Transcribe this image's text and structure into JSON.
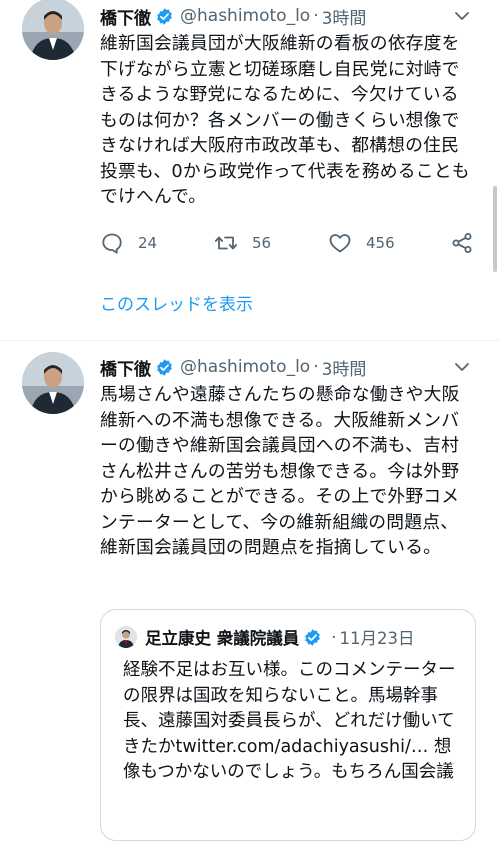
{
  "tweets": [
    {
      "author": {
        "name": "橋下徹",
        "handle": "@hashimoto_lo",
        "time": "3時間"
      },
      "text": "維新国会議員団が大阪維新の看板の依存度を下げながら立憲と切磋琢磨し自民党に対峙できるような野党になるために、今欠けているものは何か？各メンバーの働きくらい想像できなければ大阪府市政改革も、都構想の住民投票も、0から政党作って代表を務めることもでけへんで。",
      "stats": {
        "replies": "24",
        "retweets": "56",
        "likes": "456"
      },
      "thread_link": "このスレッドを表示"
    },
    {
      "author": {
        "name": "橋下徹",
        "handle": "@hashimoto_lo",
        "time": "3時間"
      },
      "text": "馬場さんや遠藤さんたちの懸命な働きや大阪維新への不満も想像できる。大阪維新メンバーの働きや維新国会議員団への不満も、吉村さん松井さんの苦労も想像できる。今は外野から眺めることができる。その上で外野コメンテーターとして、今の維新組織の問題点、維新国会議員団の問題点を指摘している。",
      "quoted": {
        "name": "足立康史 衆議院議員",
        "dot": "·",
        "date": "11月23日",
        "text": "経験不足はお互い様。このコメンテーターの限界は国政を知らないこと。馬場幹事長、遠藤国対委員長らが、どれだけ働いてきたかtwitter.com/adachiyasushi/… 想像もつかないのでしょう。もちろん国会議"
      }
    }
  ],
  "colors": {
    "text": "#0f1419",
    "secondary": "#536471",
    "accent": "#1d9bf0",
    "verified": "#1d9bf0",
    "border": "#cfd9de"
  },
  "icons": [
    "verified-badge-icon",
    "caret-down-icon",
    "reply-icon",
    "retweet-icon",
    "like-icon",
    "share-icon"
  ]
}
